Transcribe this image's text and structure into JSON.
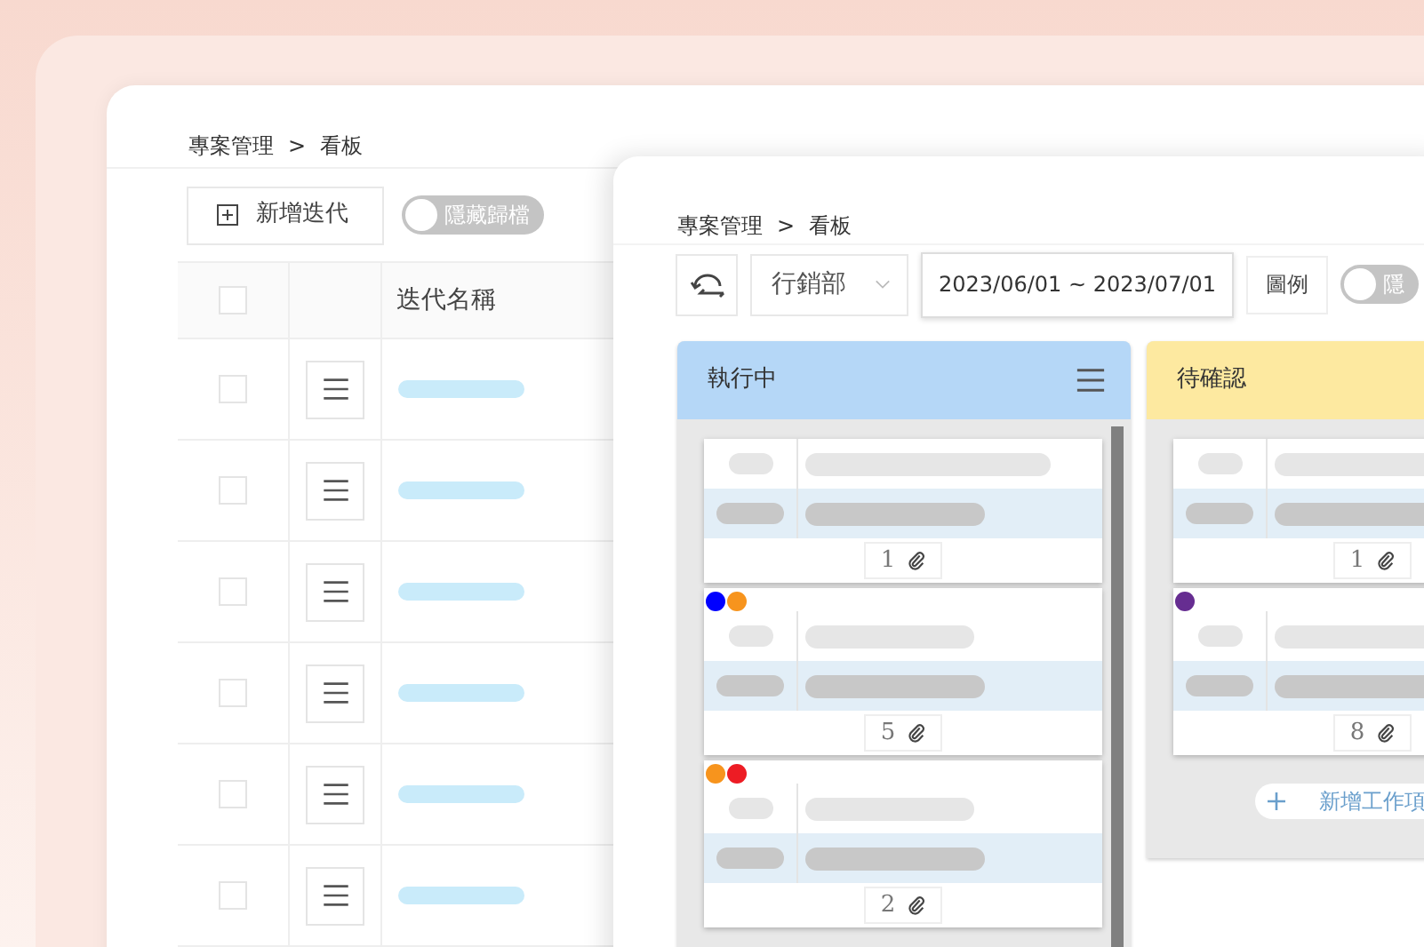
{
  "back_window": {
    "breadcrumb": [
      "專案管理",
      ">",
      "看板"
    ],
    "add_button": "新增迭代",
    "archive_toggle": {
      "label": "隱藏歸檔",
      "on": false
    },
    "table": {
      "name_column": "迭代名稱",
      "header_checked": false,
      "rows": [
        {
          "checked": false
        },
        {
          "checked": false
        },
        {
          "checked": false
        },
        {
          "checked": false
        },
        {
          "checked": false
        },
        {
          "checked": false
        }
      ]
    }
  },
  "front_window": {
    "breadcrumb": [
      "專案管理",
      ">",
      "看板"
    ],
    "department": "行銷部",
    "date_range": "2023/06/01 ~ 2023/07/01",
    "legend_button": "圖例",
    "archive_toggle": {
      "label": "隱",
      "on": false
    },
    "columns": [
      {
        "title": "執行中",
        "color": "#b5d7f7",
        "cards": [
          {
            "attachments": "1"
          },
          {
            "tags": [
              {
                "color": "#0000ff"
              },
              {
                "color": "#f7941d"
              }
            ],
            "attachments": "5"
          },
          {
            "tags": [
              {
                "color": "#f7941d"
              },
              {
                "color": "#ed1c24"
              }
            ],
            "attachments": "2"
          }
        ]
      },
      {
        "title": "待確認",
        "color": "#fde9a0",
        "cards": [
          {
            "attachments": "1"
          },
          {
            "tags": [
              {
                "color": "#662d91"
              }
            ],
            "attachments": "8"
          }
        ],
        "add_item": "新增工作項"
      }
    ]
  }
}
